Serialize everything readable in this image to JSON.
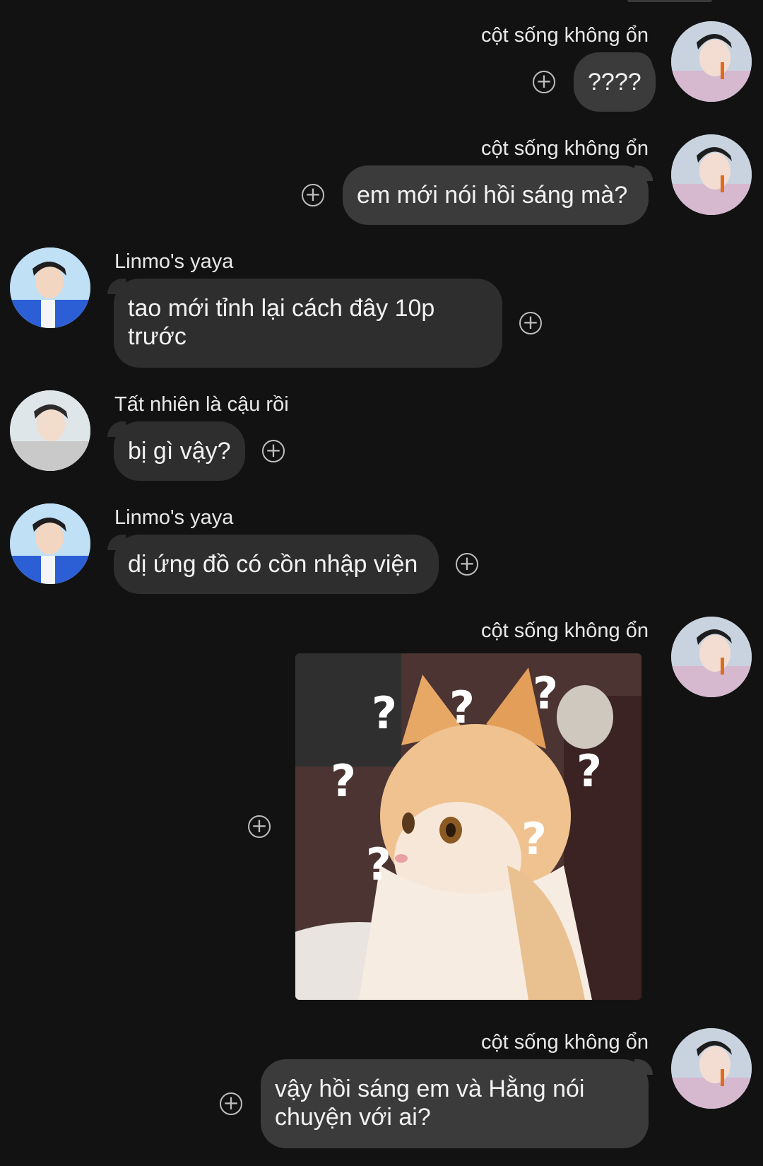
{
  "messages": [
    {
      "sender": "cột sống không ổn",
      "text": "????",
      "side": "right"
    },
    {
      "sender": "cột sống không ổn",
      "text": "em mới nói hồi sáng mà?",
      "side": "right"
    },
    {
      "sender": "Linmo's yaya",
      "text": "tao mới tỉnh lại cách đây 10p trước",
      "side": "left"
    },
    {
      "sender": "Tất nhiên là cậu rồi",
      "text": "bị gì vậy?",
      "side": "left"
    },
    {
      "sender": "Linmo's yaya",
      "text": "dị ứng đồ có cồn nhập viện",
      "side": "left"
    },
    {
      "sender": "cột sống không ổn",
      "text": "",
      "side": "right",
      "attachment": "image",
      "image_desc_icon": "confused-cat-sticker"
    },
    {
      "sender": "cột sống không ổn",
      "text": "vậy hồi sáng em và Hằng nói chuyện với ai?",
      "side": "right"
    }
  ],
  "ui": {
    "reaction_glyph": "+",
    "sticker_marks": [
      "?",
      "?",
      "?",
      "?",
      "?",
      "?",
      "?"
    ]
  },
  "colors": {
    "background": "#121212",
    "bubble_self": "#3b3b3b",
    "bubble_other": "#2e2e2e",
    "text": "#f2f2f2",
    "icon": "#bdbdbd"
  }
}
